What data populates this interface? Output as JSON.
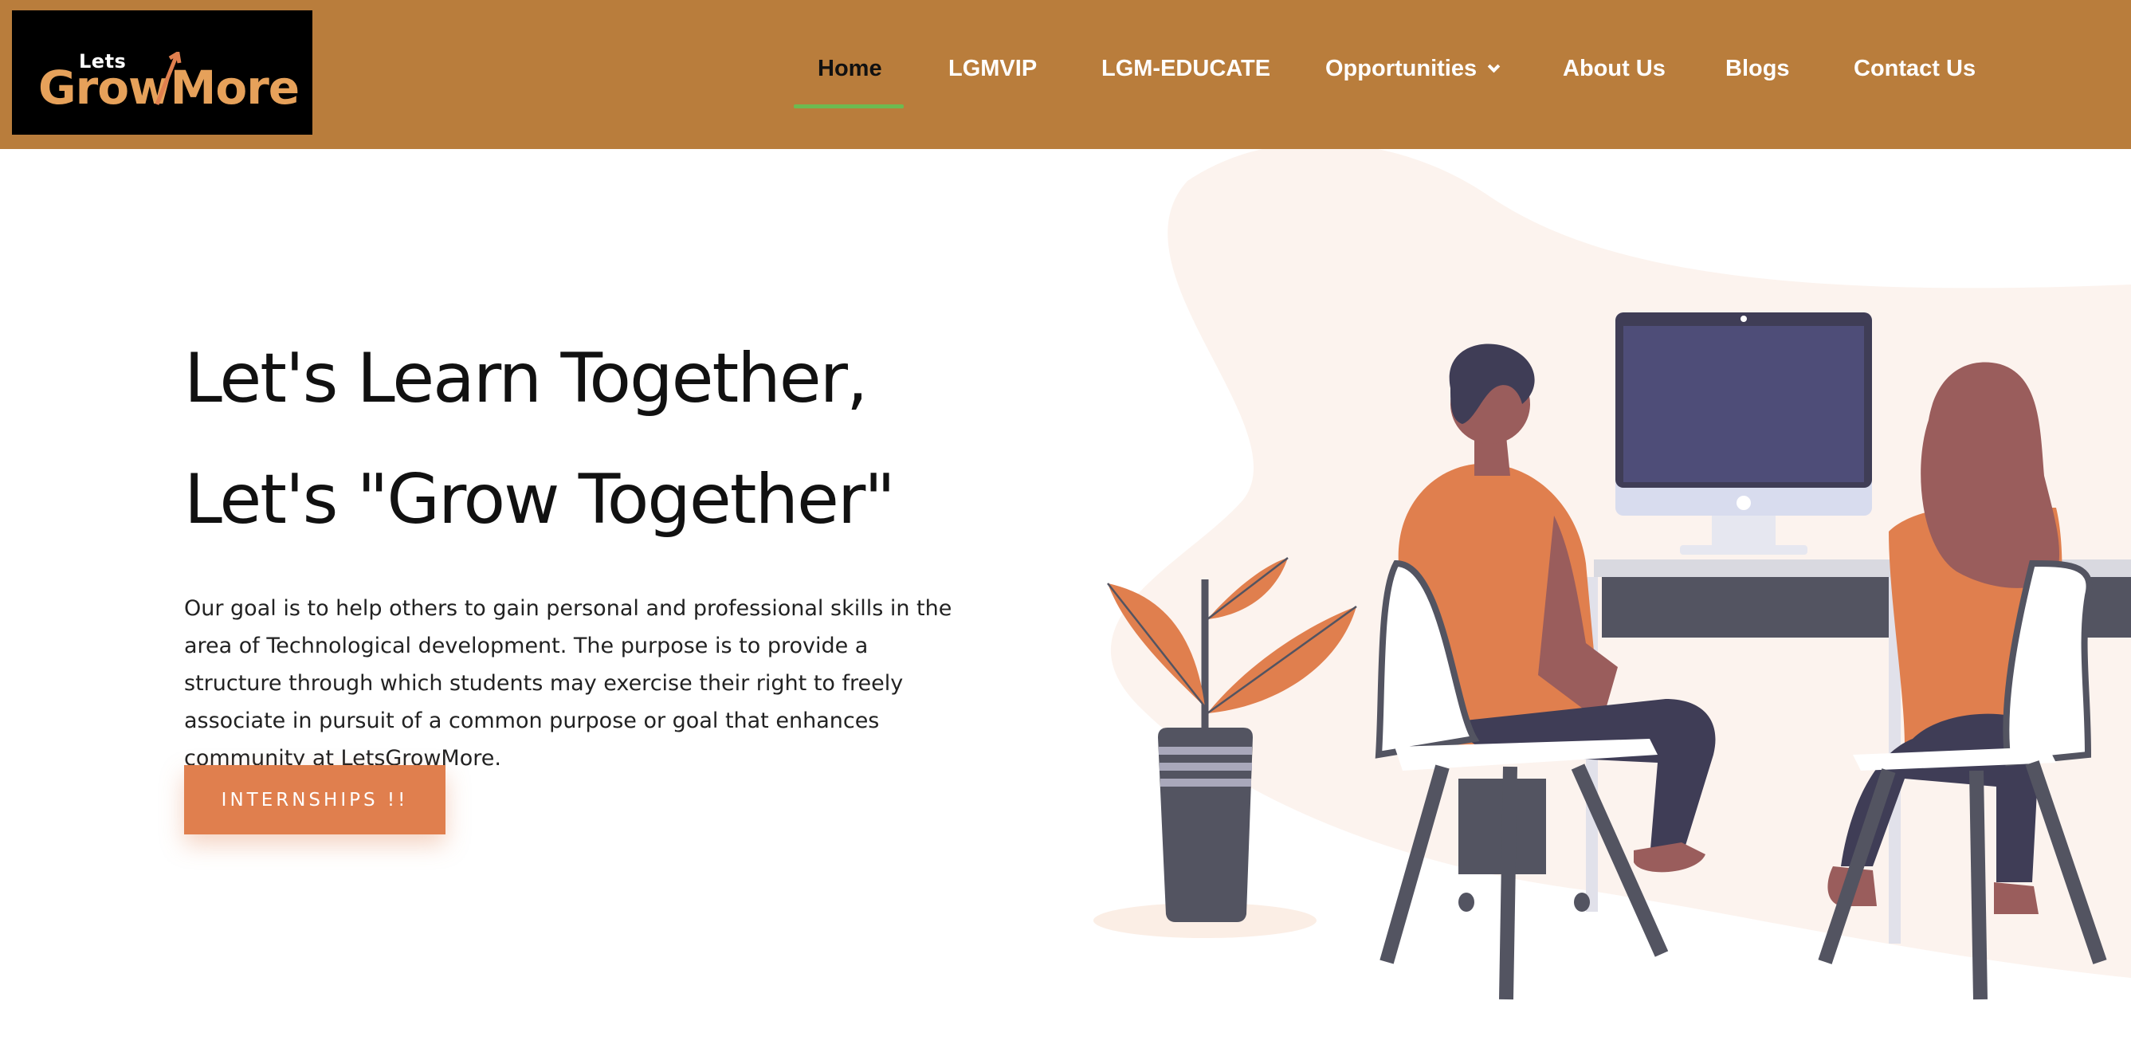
{
  "brand": {
    "logo_top": "Lets",
    "logo_main": "GrowMore"
  },
  "nav": {
    "items": [
      "Home",
      "LGMVIP",
      "LGM-EDUCATE",
      "Opportunities",
      "About Us",
      "Blogs",
      "Contact Us"
    ],
    "active": "Home"
  },
  "hero": {
    "title_line1": "Let's  Learn Together,",
    "title_line2": "Let's \"Grow Together\"",
    "description": "Our goal is to help others to gain personal and professional skills in the area of Technological development. The purpose is to provide a structure through which students may exercise their right to freely associate in pursuit of a common purpose or goal that enhances community at LetsGrowMore.",
    "cta_label": "INTERNSHIPS !!"
  },
  "colors": {
    "header_bg": "#b97d3c",
    "accent_orange": "#e07f4e",
    "nav_underline": "#6dbb51",
    "blob": "#fcf3ee"
  },
  "icons": [
    "chevron-down-icon"
  ]
}
